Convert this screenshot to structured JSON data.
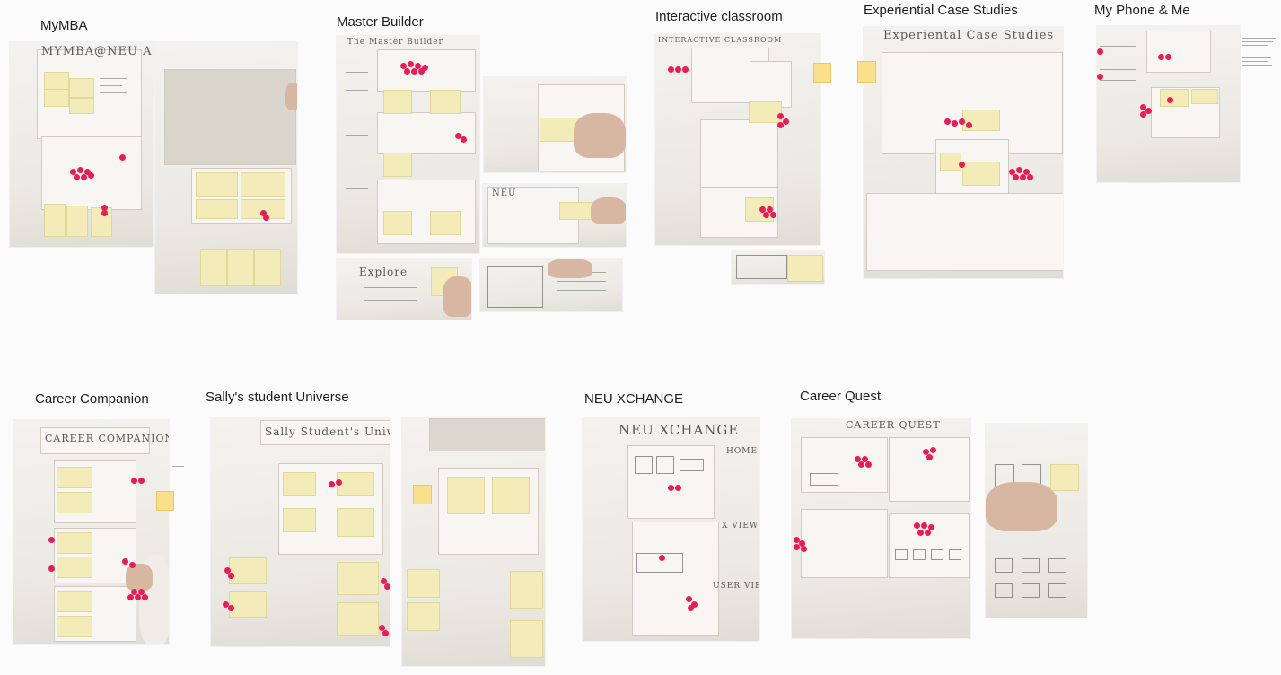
{
  "groups": [
    {
      "id": "mymba",
      "title": "MyMBA"
    },
    {
      "id": "master_builder",
      "title": "Master Builder"
    },
    {
      "id": "interactive_classroom",
      "title": "Interactive classroom"
    },
    {
      "id": "experiential_case_studies",
      "title": "Experiential Case Studies"
    },
    {
      "id": "my_phone_me",
      "title": "My Phone & Me"
    },
    {
      "id": "career_companion",
      "title": "Career Companion"
    },
    {
      "id": "sallys_student_universe",
      "title": "Sally's student Universe"
    },
    {
      "id": "neu_xchange",
      "title": "NEU XCHANGE"
    },
    {
      "id": "career_quest",
      "title": "Career Quest"
    }
  ],
  "colors": {
    "vote_dot": "#ec1a55",
    "sticky": "#f3ecb8",
    "canvas": "#fbfbfb"
  }
}
